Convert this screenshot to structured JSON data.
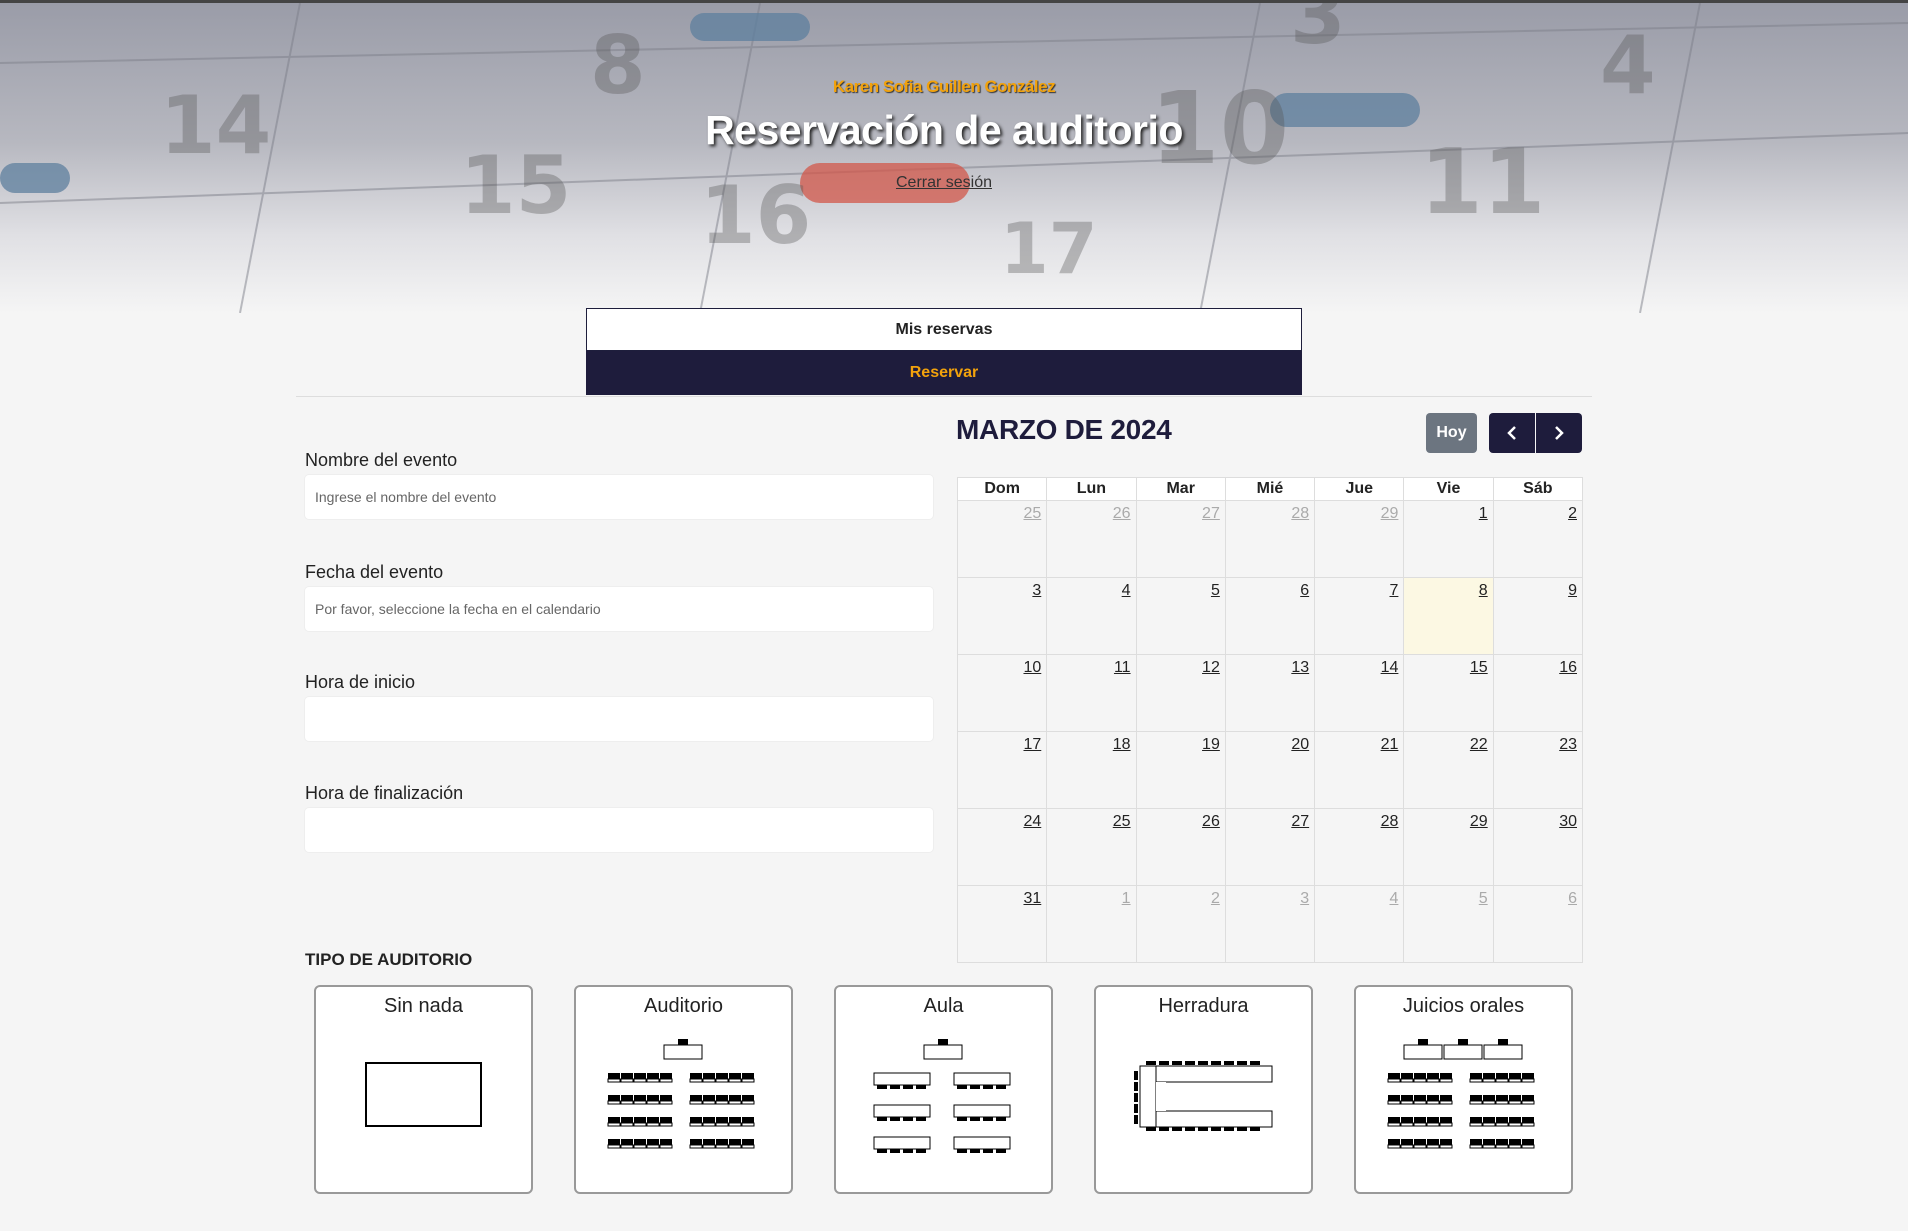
{
  "header": {
    "user_name": "Karen Sofia Guillen González",
    "title": "Reservación de auditorio",
    "logout_label": "Cerrar sesión"
  },
  "tabs": [
    {
      "label": "Mis reservas",
      "active": false
    },
    {
      "label": "Reservar",
      "active": true
    }
  ],
  "form": {
    "event_name": {
      "label": "Nombre del evento",
      "placeholder": "Ingrese el nombre del evento",
      "value": ""
    },
    "event_date": {
      "label": "Fecha del evento",
      "placeholder": "Por favor, seleccione la fecha en el calendario",
      "value": ""
    },
    "start_time": {
      "label": "Hora de inicio",
      "value": ""
    },
    "end_time": {
      "label": "Hora de finalización",
      "value": ""
    }
  },
  "calendar": {
    "title": "MARZO DE 2024",
    "today_label": "Hoy",
    "weekdays": [
      "Dom",
      "Lun",
      "Mar",
      "Mié",
      "Jue",
      "Vie",
      "Sáb"
    ],
    "weeks": [
      [
        {
          "d": "25",
          "o": true
        },
        {
          "d": "26",
          "o": true
        },
        {
          "d": "27",
          "o": true
        },
        {
          "d": "28",
          "o": true
        },
        {
          "d": "29",
          "o": true
        },
        {
          "d": "1"
        },
        {
          "d": "2"
        }
      ],
      [
        {
          "d": "3"
        },
        {
          "d": "4"
        },
        {
          "d": "5"
        },
        {
          "d": "6"
        },
        {
          "d": "7"
        },
        {
          "d": "8",
          "today": true
        },
        {
          "d": "9"
        }
      ],
      [
        {
          "d": "10"
        },
        {
          "d": "11"
        },
        {
          "d": "12"
        },
        {
          "d": "13"
        },
        {
          "d": "14"
        },
        {
          "d": "15"
        },
        {
          "d": "16"
        }
      ],
      [
        {
          "d": "17"
        },
        {
          "d": "18"
        },
        {
          "d": "19"
        },
        {
          "d": "20"
        },
        {
          "d": "21"
        },
        {
          "d": "22"
        },
        {
          "d": "23"
        }
      ],
      [
        {
          "d": "24"
        },
        {
          "d": "25"
        },
        {
          "d": "26"
        },
        {
          "d": "27"
        },
        {
          "d": "28"
        },
        {
          "d": "29"
        },
        {
          "d": "30"
        }
      ],
      [
        {
          "d": "31"
        },
        {
          "d": "1",
          "o": true
        },
        {
          "d": "2",
          "o": true
        },
        {
          "d": "3",
          "o": true
        },
        {
          "d": "4",
          "o": true
        },
        {
          "d": "5",
          "o": true
        },
        {
          "d": "6",
          "o": true
        }
      ]
    ]
  },
  "auditorium": {
    "title": "TIPO DE AUDITORIO",
    "types": [
      {
        "label": "Sin nada",
        "icon": "empty-room-icon"
      },
      {
        "label": "Auditorio",
        "icon": "auditorium-layout-icon"
      },
      {
        "label": "Aula",
        "icon": "classroom-layout-icon"
      },
      {
        "label": "Herradura",
        "icon": "horseshoe-layout-icon"
      },
      {
        "label": "Juicios orales",
        "icon": "oral-trials-layout-icon"
      }
    ]
  },
  "colors": {
    "accent": "#f2a20c",
    "navy": "#1e1c3c",
    "today_bg": "#fcf8e3",
    "hoy_button": "#6c7580"
  }
}
